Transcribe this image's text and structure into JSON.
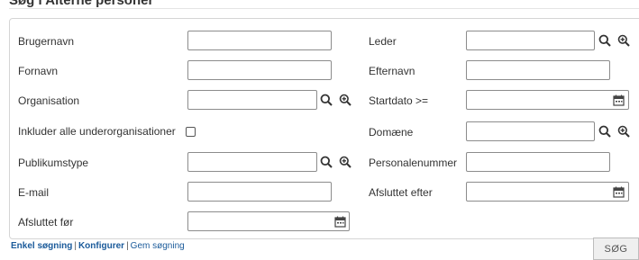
{
  "page_title": "Søg i Alterne personer",
  "fields": {
    "brugernavn": {
      "label": "Brugernavn",
      "value": ""
    },
    "fornavn": {
      "label": "Fornavn",
      "value": ""
    },
    "organisation": {
      "label": "Organisation",
      "value": ""
    },
    "inkluder": {
      "label": "Inkluder alle underorganisationer",
      "checked": false
    },
    "publikumstype": {
      "label": "Publikumstype",
      "value": ""
    },
    "email": {
      "label": "E-mail",
      "value": ""
    },
    "afsluttet_foer": {
      "label": "Afsluttet før",
      "value": ""
    },
    "leder": {
      "label": "Leder",
      "value": ""
    },
    "efternavn": {
      "label": "Efternavn",
      "value": ""
    },
    "startdato": {
      "label": "Startdato >=",
      "value": ""
    },
    "domaene": {
      "label": "Domæne",
      "value": ""
    },
    "personalenummer": {
      "label": "Personalenummer",
      "value": ""
    },
    "afsluttet_efter": {
      "label": "Afsluttet efter",
      "value": ""
    }
  },
  "icons": {
    "search": "search-icon",
    "zoom_in": "zoom-in-icon",
    "calendar": "calendar-icon"
  },
  "footer": {
    "simple_search": "Enkel søgning",
    "configure": "Konfigurer",
    "save_search": "Gem søgning",
    "separator": "|"
  },
  "search_button": "SØG",
  "colors": {
    "link": "#1a5a9a",
    "border": "#8c8c8c"
  }
}
